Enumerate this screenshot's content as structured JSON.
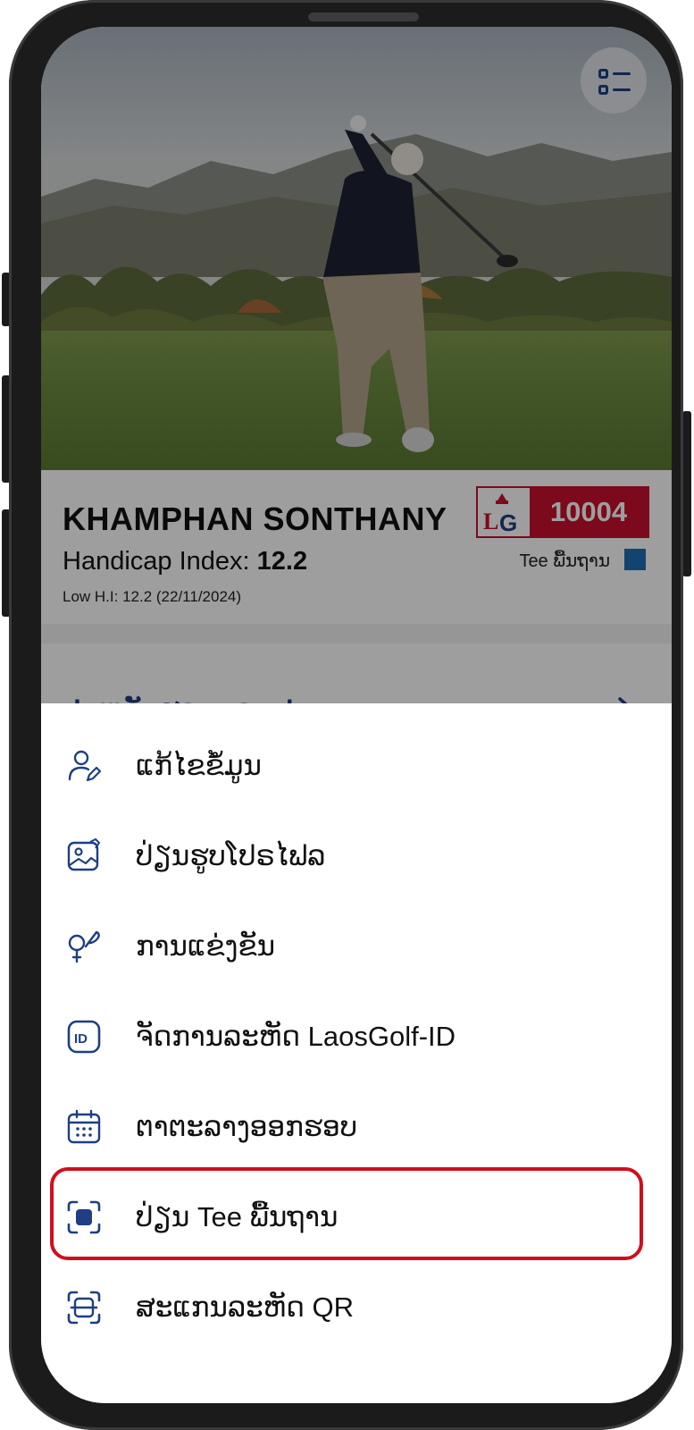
{
  "profile": {
    "name": "KHAMPHAN SONTHANY",
    "handicap_label": "Handicap Index:",
    "handicap_value": "12.2",
    "low_hi": "Low H.I: 12.2 (22/11/2024)",
    "member_id": "10004",
    "tee_label": "Tee ພື້ນຖານ",
    "tee_color": "#1f6fb5"
  },
  "history": {
    "title": "ປະຫວັດຮອບກອລຟ"
  },
  "menu": {
    "items": [
      {
        "label": "ແກ້ໄຂຂໍ້ມູນ",
        "icon": "user-edit-icon"
      },
      {
        "label": "ປ່ຽນຮູບໂປຣໄຟລ",
        "icon": "image-edit-icon"
      },
      {
        "label": "ການແຂ່ງຂັນ",
        "icon": "golf-club-icon"
      },
      {
        "label": "ຈັດການລະຫັດ LaosGolf-ID",
        "icon": "id-badge-icon"
      },
      {
        "label": "ຕາຕະລາງອອກຮອບ",
        "icon": "calendar-icon"
      },
      {
        "label": "ປ່ຽນ Tee ພື້ນຖານ",
        "icon": "tee-select-icon",
        "highlighted": true
      },
      {
        "label": "ສະແກນລະຫັດ QR",
        "icon": "qr-scan-icon"
      }
    ]
  },
  "colors": {
    "brand_blue": "#1e3f82",
    "brand_red": "#c8102e",
    "highlight": "#cf101c"
  }
}
